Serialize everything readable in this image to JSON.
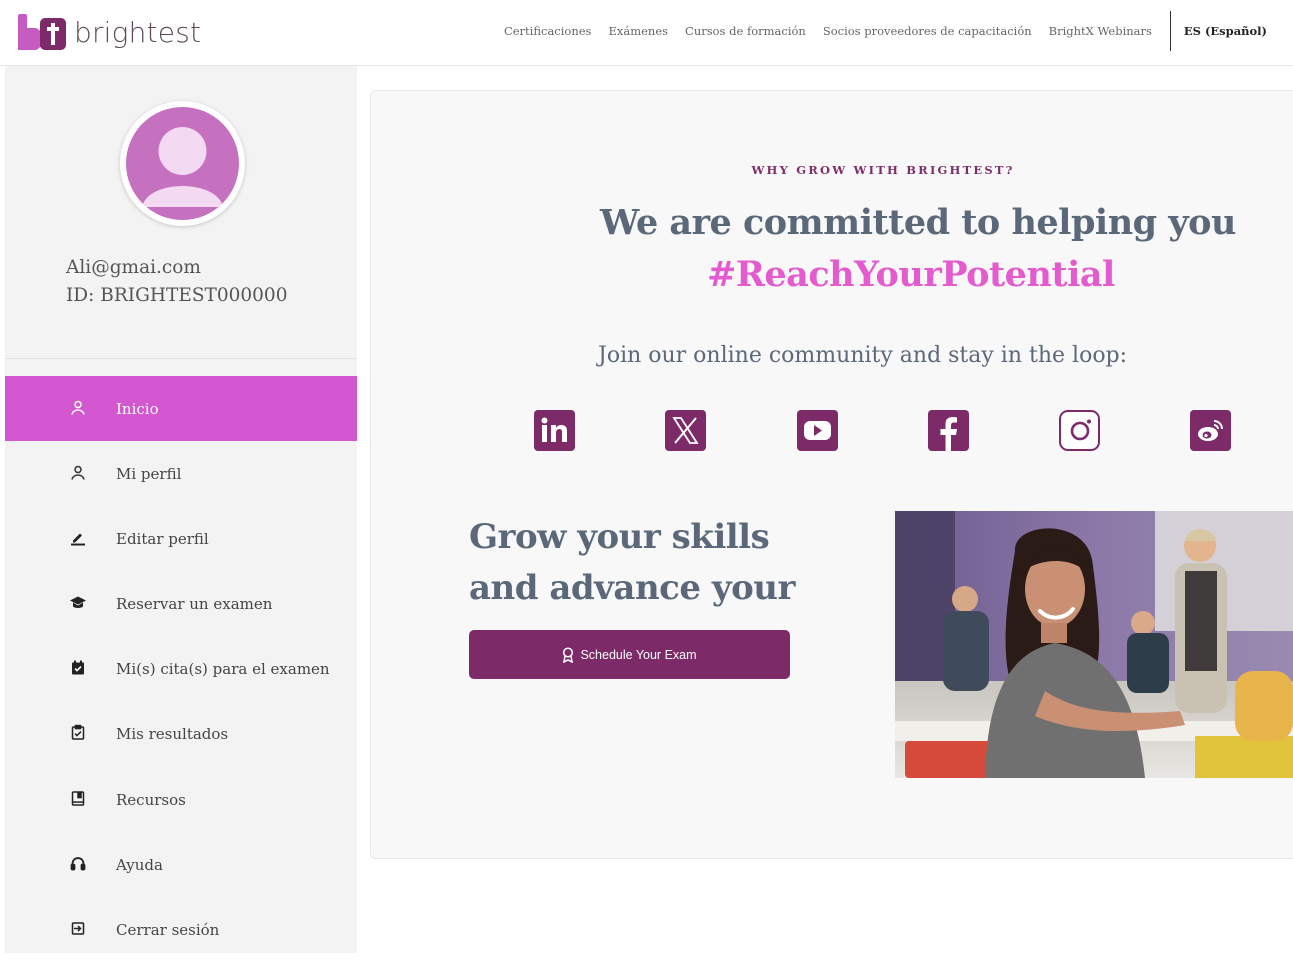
{
  "header": {
    "logo_text": "brightest",
    "nav": [
      "Certificaciones",
      "Exámenes",
      "Cursos de formación",
      "Socios proveedores de capacitación",
      "BrightX Webinars"
    ],
    "language": "ES (Español)"
  },
  "user": {
    "email": "Ali@gmai.com",
    "id": "ID: BRIGHTEST000000"
  },
  "sidebar": {
    "items": [
      {
        "label": "Inicio",
        "icon": "user-icon",
        "active": true
      },
      {
        "label": "Mi perfil",
        "icon": "user-icon",
        "active": false
      },
      {
        "label": "Editar perfil",
        "icon": "pencil-icon",
        "active": false
      },
      {
        "label": "Reservar un examen",
        "icon": "graduation-cap-icon",
        "active": false
      },
      {
        "label": "Mi(s) cita(s) para el examen",
        "icon": "calendar-check-icon",
        "active": false
      },
      {
        "label": "Mis resultados",
        "icon": "clipboard-check-icon",
        "active": false
      },
      {
        "label": "Recursos",
        "icon": "book-icon",
        "active": false
      },
      {
        "label": "Ayuda",
        "icon": "headset-icon",
        "active": false
      },
      {
        "label": "Cerrar sesión",
        "icon": "sign-out-icon",
        "active": false
      }
    ]
  },
  "main": {
    "eyebrow": "WHY GROW WITH BRIGHTEST?",
    "headline_line1": "We are committed to helping you",
    "headline_line2": "#ReachYourPotential",
    "join_text": "Join our online community and stay in the loop:",
    "socials": [
      "linkedin-icon",
      "x-icon",
      "youtube-icon",
      "facebook-icon",
      "instagram-icon",
      "weibo-icon"
    ],
    "grow_text": "Grow your skills and advance your career",
    "cta_label": "Schedule Your Exam"
  },
  "colors": {
    "accent": "#d257d0",
    "brand_dark": "#7c2a68",
    "headline": "#5b6879",
    "hashtag": "#e35bcf"
  }
}
